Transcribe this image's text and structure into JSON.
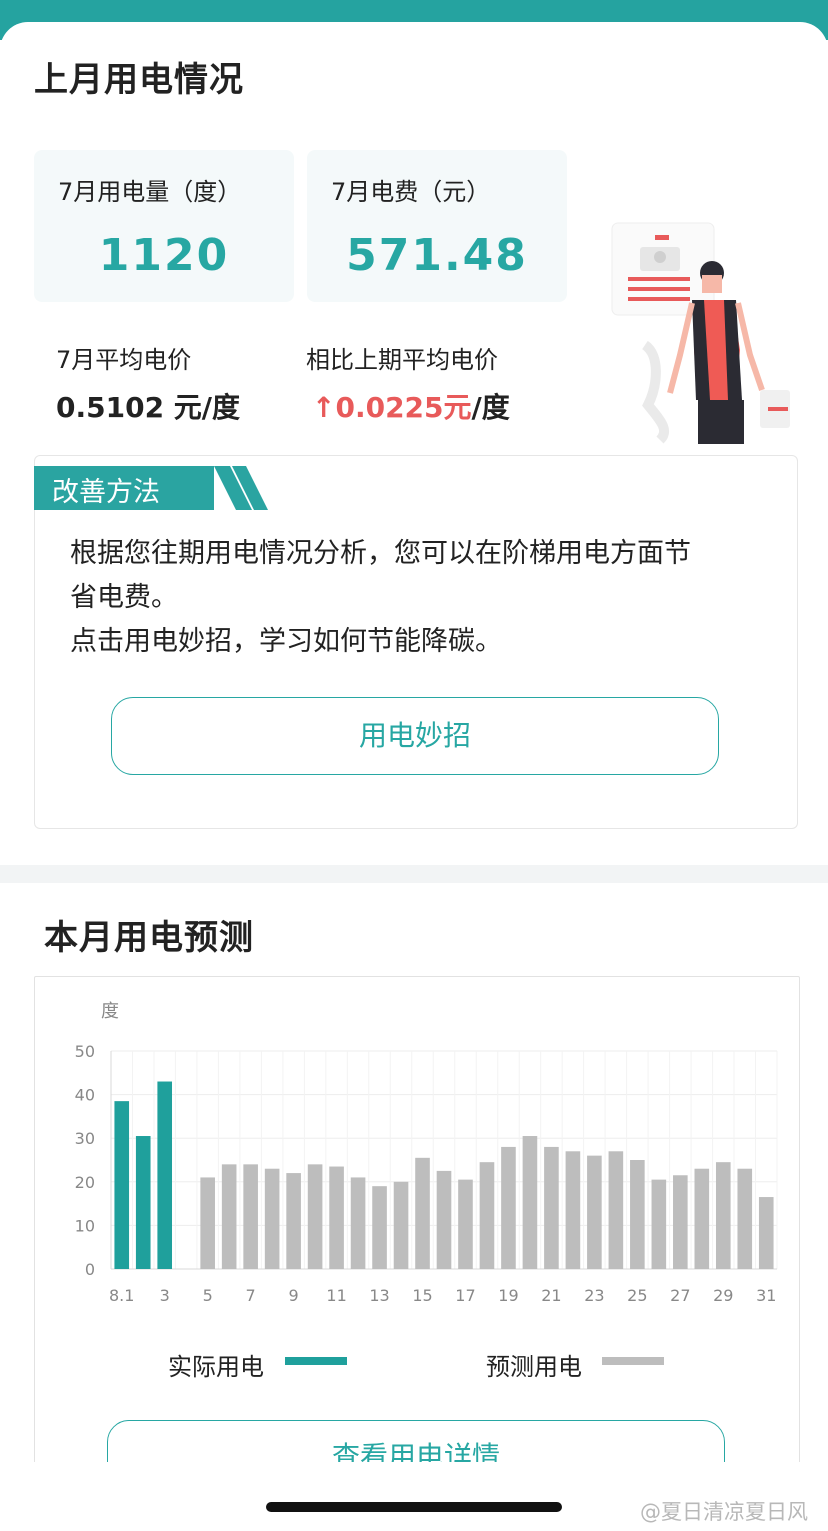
{
  "header": {
    "title": "上月用电情况"
  },
  "stats": {
    "usage_label": "7月用电量（度）",
    "usage_value": "1120",
    "fee_label": "7月电费（元）",
    "fee_value": "571.48"
  },
  "avg_price": {
    "label": "7月平均电价",
    "value": "0.5102 元/度",
    "compare_label": "相比上期平均电价",
    "compare_arrow": "↑",
    "compare_value": "0.0225元",
    "compare_unit": "/度"
  },
  "improve": {
    "tag": "改善方法",
    "line1": "根据您往期用电情况分析，您可以在阶梯用电方面节",
    "line2": "省电费。",
    "line3": "点击用电妙招，学习如何节能降碳。",
    "button": "用电妙招"
  },
  "forecast": {
    "title": "本月用电预测",
    "detail_button": "查看用电详情",
    "legend_actual": "实际用电",
    "legend_predicted": "预测用电"
  },
  "chart_data": {
    "type": "bar",
    "ylabel": "度",
    "ylim": [
      0,
      50
    ],
    "yticks": [
      0,
      10,
      20,
      30,
      40,
      50
    ],
    "categories": [
      "8.1",
      "2",
      "3",
      "4",
      "5",
      "6",
      "7",
      "8",
      "9",
      "10",
      "11",
      "12",
      "13",
      "14",
      "15",
      "16",
      "17",
      "18",
      "19",
      "20",
      "21",
      "22",
      "23",
      "24",
      "25",
      "26",
      "27",
      "28",
      "29",
      "30",
      "31"
    ],
    "xtick_labels": [
      "8.1",
      "3",
      "5",
      "7",
      "9",
      "11",
      "13",
      "15",
      "17",
      "19",
      "21",
      "23",
      "25",
      "27",
      "29",
      "31"
    ],
    "series": [
      {
        "name": "实际用电",
        "color": "#1fa09c",
        "values": [
          38.5,
          30.5,
          43,
          null,
          null,
          null,
          null,
          null,
          null,
          null,
          null,
          null,
          null,
          null,
          null,
          null,
          null,
          null,
          null,
          null,
          null,
          null,
          null,
          null,
          null,
          null,
          null,
          null,
          null,
          null,
          null
        ]
      },
      {
        "name": "预测用电",
        "color": "#bdbdbd",
        "values": [
          null,
          null,
          null,
          null,
          21,
          24,
          24,
          23,
          22,
          24,
          23.5,
          21,
          19,
          20,
          25.5,
          22.5,
          20.5,
          24.5,
          28,
          30.5,
          28,
          27,
          26,
          27,
          25,
          20.5,
          21.5,
          23,
          24.5,
          23,
          16.5
        ]
      }
    ],
    "grid": true
  },
  "watermark": "@夏日清凉夏日风",
  "colors": {
    "accent": "#27a7a3",
    "up": "#e85a5a",
    "predicted": "#bdbdbd"
  }
}
